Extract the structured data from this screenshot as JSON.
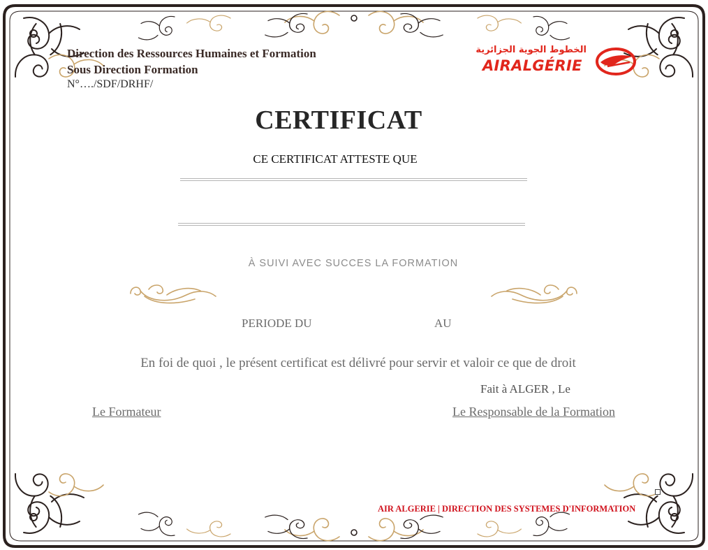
{
  "header": {
    "line1": "Direction des Ressources Humaines et Formation",
    "line2": "Sous Direction Formation",
    "reference": "N°…./SDF/DRHF/"
  },
  "logo": {
    "arabic": "الخطوط الجوية الجزائرية",
    "latin": "AIRALGÉRIE",
    "emblem_icon": "air-algerie-bird-emblem",
    "brand_color": "#e1261c"
  },
  "certificate": {
    "title": "CERTIFICAT",
    "attest": "CE CERTIFICAT ATTESTE QUE",
    "suivi": "À SUIVI AVEC SUCCES LA FORMATION",
    "periode_du": "PERIODE  DU",
    "periode_au": "AU",
    "foi": "En foi de quoi , le présent certificat est délivré pour servir et valoir ce que de droit",
    "fait": "Fait à ALGER , Le",
    "formateur": "Le Formateur",
    "responsable": "Le Responsable de la Formation"
  },
  "footer": {
    "text": "AIR ALGERIE | DIRECTION DES SYSTEMES D'INFORMATION",
    "color": "#d0121d"
  },
  "decor": {
    "frame_color": "#2b211f",
    "gold_color": "#c9a46a"
  }
}
